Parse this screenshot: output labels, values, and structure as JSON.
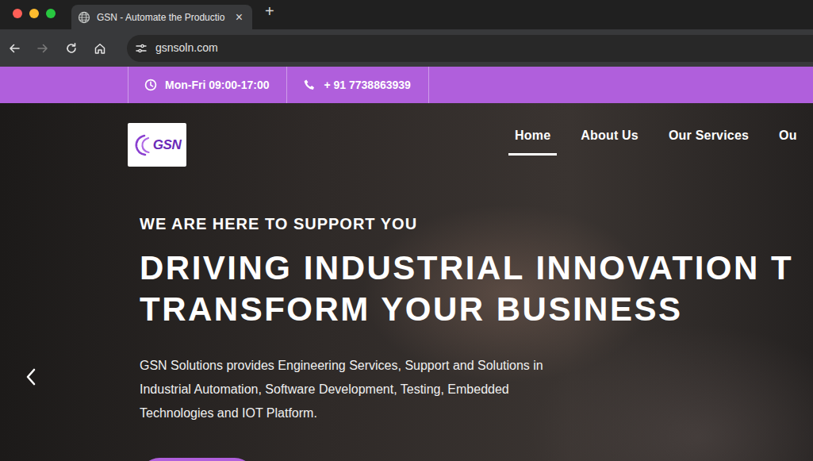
{
  "window": {
    "controls": [
      {
        "kind": "close",
        "color": "#ff5f57"
      },
      {
        "kind": "minimize",
        "color": "#febc2e"
      },
      {
        "kind": "zoom",
        "color": "#28c840"
      }
    ]
  },
  "tabs": [
    {
      "title": "GSN - Automate the Productio",
      "close": "×",
      "selected": true
    }
  ],
  "new_tab": "+",
  "toolbar": {
    "back_enabled": true,
    "forward_enabled": false,
    "url": "gsnsoln.com"
  },
  "topbar": [
    {
      "kind": "hours",
      "text": "Mon-Fri 09:00-17:00"
    },
    {
      "kind": "phone",
      "text": "+ 91 7738863939"
    }
  ],
  "site": {
    "logo": "GSN",
    "nav": [
      {
        "label": "Home",
        "selected": true
      },
      {
        "label": "About Us",
        "selected": false
      },
      {
        "label": "Our Services",
        "selected": false
      },
      {
        "label": "Ou",
        "selected": false
      }
    ]
  },
  "hero": {
    "eyebrow": "WE ARE HERE TO SUPPORT YOU",
    "headline": [
      "DRIVING INDUSTRIAL INNOVATION T",
      "TRANSFORM YOUR BUSINESS"
    ],
    "text": [
      "GSN Solutions provides Engineering Services, Support and Solutions in",
      "Industrial Automation, Software Development, Testing, Embedded",
      "Technologies and IOT Platform."
    ]
  }
}
